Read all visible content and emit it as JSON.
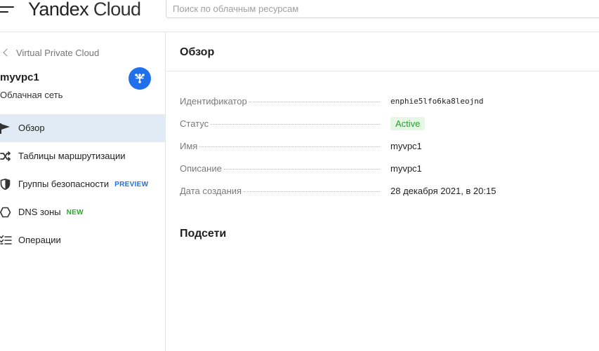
{
  "header": {
    "logo_brand": "Yandex",
    "logo_product": "Cloud",
    "search_placeholder": "Поиск по облачным ресурсам"
  },
  "sidebar": {
    "back_label": "Virtual Private Cloud",
    "vpc_name": "myvpc1",
    "vpc_type": "Облачная сеть",
    "badge_color": "#1f70ea",
    "items": [
      {
        "label": "Обзор",
        "icon": "flag-icon",
        "active": true
      },
      {
        "label": "Таблицы маршрутизации",
        "icon": "shuffle-icon"
      },
      {
        "label": "Группы безопасности",
        "icon": "shield-icon",
        "tag": "PREVIEW"
      },
      {
        "label": "DNS зоны",
        "icon": "hexagon-icon",
        "tag": "NEW"
      },
      {
        "label": "Операции",
        "icon": "checklist-icon"
      }
    ]
  },
  "main": {
    "title": "Обзор",
    "properties": [
      {
        "key": "Идентификатор",
        "value": "enphie5lfo6ka8leojnd"
      },
      {
        "key": "Статус",
        "value": "Active"
      },
      {
        "key": "Имя",
        "value": "myvpc1"
      },
      {
        "key": "Описание",
        "value": "myvpc1"
      },
      {
        "key": "Дата создания",
        "value": "28 декабря 2021, в 20:15"
      }
    ],
    "subnets_title": "Подсети"
  },
  "colors": {
    "accent": "#1f70ea",
    "active_nav_bg": "#e1ebf6",
    "status_green": "#2a9c2a",
    "new_green": "#2fa42f"
  }
}
